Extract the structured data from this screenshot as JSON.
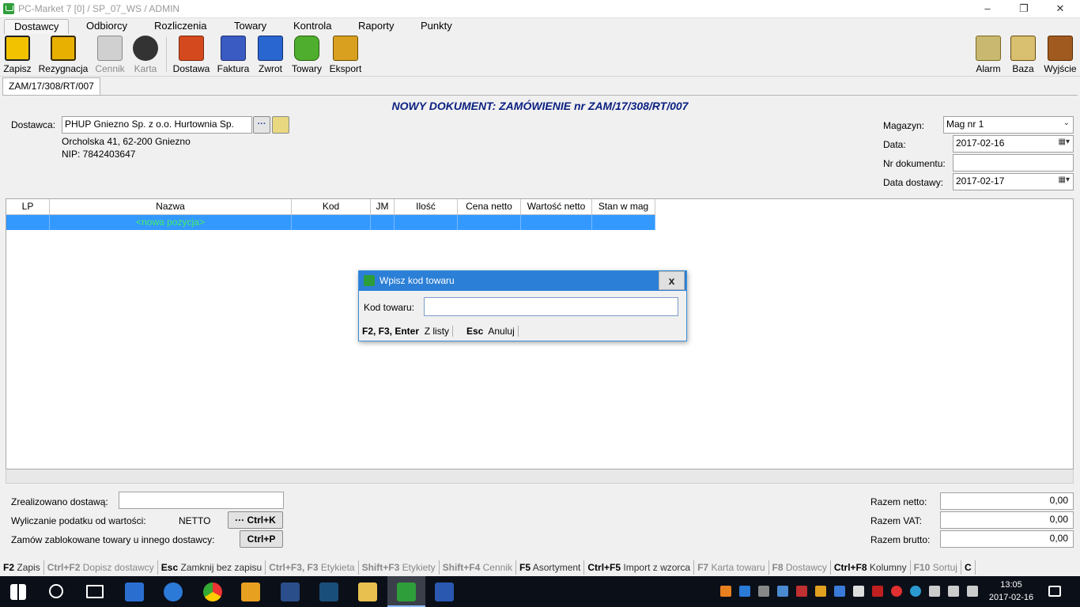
{
  "window": {
    "title": "PC-Market 7 [0] / SP_07_WS / ADMIN",
    "minimize": "‒",
    "restore": "❐",
    "close": "✕"
  },
  "menu": [
    "Dostawcy",
    "Odbiorcy",
    "Rozliczenia",
    "Towary",
    "Kontrola",
    "Raporty",
    "Punkty"
  ],
  "toolbar": {
    "left": [
      {
        "label": "Zapisz",
        "icon": "save-icon"
      },
      {
        "label": "Rezygnacja",
        "icon": "undo-icon"
      },
      {
        "label": "Cennik",
        "icon": "price-list-icon"
      },
      {
        "label": "Karta",
        "icon": "apple-card-icon"
      },
      {
        "label": "Dostawa",
        "icon": "vat-truck-icon"
      },
      {
        "label": "Faktura",
        "icon": "vat-invoice-icon"
      },
      {
        "label": "Zwrot",
        "icon": "return-icon"
      },
      {
        "label": "Towary",
        "icon": "goods-basket-icon"
      },
      {
        "label": "Eksport",
        "icon": "export-icon"
      }
    ],
    "right": [
      {
        "label": "Alarm",
        "icon": "alarm-icon"
      },
      {
        "label": "Baza",
        "icon": "database-tools-icon"
      },
      {
        "label": "Wyjście",
        "icon": "exit-door-icon"
      }
    ]
  },
  "doc_tab": "ZAM/17/308/RT/007",
  "doc_title": "NOWY DOKUMENT: ZAMÓWIENIE nr ZAM/17/308/RT/007",
  "supplier": {
    "label": "Dostawca:",
    "name": "PHUP Gniezno Sp. z o.o. Hurtownia Sp.",
    "browse_btn": "···",
    "address": "Orcholska 41, 62-200 Gniezno",
    "nip": "NIP: 7842403647"
  },
  "right_fields": {
    "warehouse_label": "Magazyn:",
    "warehouse_value": "Mag nr 1",
    "date_label": "Data:",
    "date_value": "2017-02-16",
    "docnum_label": "Nr dokumentu:",
    "docnum_value": "",
    "delivery_label": "Data dostawy:",
    "delivery_value": "2017-02-17"
  },
  "grid": {
    "columns": [
      "LP",
      "Nazwa",
      "Kod",
      "JM",
      "Ilość",
      "Cena netto",
      "Wartość netto",
      "Stan w mag"
    ],
    "new_row_text": "<nowa pozycja>"
  },
  "dialog": {
    "title": "Wpisz kod towaru",
    "close": "x",
    "field_label": "Kod towaru:",
    "field_value": "",
    "key1": "F2, F3, Enter",
    "action1": "Z listy",
    "key2": "Esc",
    "action2": "Anuluj"
  },
  "bottom": {
    "realized_label": "Zrealizowano dostawą:",
    "realized_value": "",
    "tax_label": "Wyliczanie podatku od wartości:",
    "tax_value": "NETTO",
    "ctrlk_label": "··· Ctrl+K",
    "blocked_label": "Zamów zablokowane towary u innego dostawcy:",
    "ctrlp_label": "Ctrl+P",
    "net_label": "Razem netto:",
    "net_value": "0,00",
    "vat_label": "Razem VAT:",
    "vat_value": "0,00",
    "gross_label": "Razem brutto:",
    "gross_value": "0,00"
  },
  "statusbar": [
    {
      "key": "F2",
      "text": "Zapis",
      "dim": false
    },
    {
      "key": "Ctrl+F2",
      "text": "Dopisz dostawcy",
      "dim": true
    },
    {
      "key": "Esc",
      "text": "Zamknij bez zapisu",
      "dim": false
    },
    {
      "key": "Ctrl+F3, F3",
      "text": "Etykieta",
      "dim": true
    },
    {
      "key": "Shift+F3",
      "text": "Etykiety",
      "dim": true
    },
    {
      "key": "Shift+F4",
      "text": "Cennik",
      "dim": true
    },
    {
      "key": "F5",
      "text": "Asortyment",
      "dim": false
    },
    {
      "key": "Ctrl+F5",
      "text": "Import z wzorca",
      "dim": false
    },
    {
      "key": "F7",
      "text": "Karta towaru",
      "dim": true
    },
    {
      "key": "F8",
      "text": "Dostawcy",
      "dim": true
    },
    {
      "key": "Ctrl+F8",
      "text": "Kolumny",
      "dim": false
    },
    {
      "key": "F10",
      "text": "Sortuj",
      "dim": true
    },
    {
      "key": "C",
      "text": "",
      "dim": false
    }
  ],
  "taskbar": {
    "time": "13:05",
    "date": "2017-02-16"
  }
}
